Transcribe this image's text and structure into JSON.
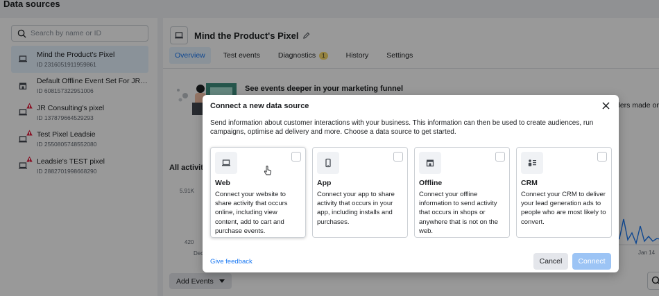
{
  "page": {
    "title": "Data sources"
  },
  "sidebar": {
    "search_placeholder": "Search by name or ID",
    "sources": [
      {
        "name": "Mind the Product's Pixel",
        "id": "ID 2316051911959861",
        "icon": "laptop-icon",
        "warning": false,
        "selected": true
      },
      {
        "name": "Default Offline Event Set For JR Con...",
        "id": "ID 608157322951006",
        "icon": "store-icon",
        "warning": false,
        "selected": false
      },
      {
        "name": "JR Consulting's pixel",
        "id": "ID 137879664529293",
        "icon": "laptop-icon",
        "warning": true,
        "selected": false
      },
      {
        "name": "Test Pixel Leadsie",
        "id": "ID 2550805748552080",
        "icon": "laptop-icon",
        "warning": true,
        "selected": false
      },
      {
        "name": "Leadsie's TEST pixel",
        "id": "ID 2882701998668290",
        "icon": "laptop-icon",
        "warning": true,
        "selected": false
      }
    ]
  },
  "pixel": {
    "name": "Mind the Product's Pixel",
    "tabs": [
      {
        "label": "Overview",
        "active": true
      },
      {
        "label": "Test events",
        "active": false
      },
      {
        "label": "Diagnostics",
        "active": false,
        "badge": "1"
      },
      {
        "label": "History",
        "active": false
      },
      {
        "label": "Settings",
        "active": false
      }
    ],
    "promo_title": "See events deeper in your marketing funnel",
    "promo_tail": "ders made on a",
    "all_activity": "All activity",
    "y_top": "5.91K",
    "y_bottom": "420",
    "x_start": "Dec",
    "x_end": "Jan 14",
    "add_events_label": "Add Events"
  },
  "modal": {
    "title": "Connect a new data source",
    "description": "Send information about customer interactions with your business. This information can then be used to create audiences, run campaigns, optimise ad delivery and more. Choose a data source to get started.",
    "options": [
      {
        "title": "Web",
        "description": "Connect your website to share activity that occurs online, including view content, add to cart and purchase events.",
        "icon": "laptop-icon"
      },
      {
        "title": "App",
        "description": "Connect your app to share activity that occurs in your app, including installs and purchases.",
        "icon": "mobile-icon"
      },
      {
        "title": "Offline",
        "description": "Connect your offline information to send activity that occurs in shops or anywhere that is not on the web.",
        "icon": "store-icon"
      },
      {
        "title": "CRM",
        "description": "Connect your CRM to deliver your lead generation ads to people who are most likely to convert.",
        "icon": "people-icon"
      }
    ],
    "feedback_label": "Give feedback",
    "cancel_label": "Cancel",
    "connect_label": "Connect"
  },
  "colors": {
    "accent": "#1877f2",
    "connect_disabled": "#9cc4f5",
    "warning": "#e41e3f",
    "badge": "#f7d96b"
  }
}
